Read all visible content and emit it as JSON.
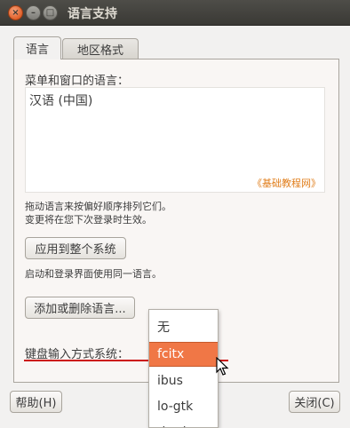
{
  "window": {
    "title": "语言支持"
  },
  "tabs": [
    {
      "label": "语言",
      "active": true
    },
    {
      "label": "地区格式",
      "active": false
    }
  ],
  "language_section": {
    "title": "菜单和窗口的语言：",
    "languages": [
      "汉语 (中国)"
    ],
    "watermark": "《基础教程网》",
    "hint_line1": "拖动语言来按偏好顺序排列它们。",
    "hint_line2": "变更将在您下次登录时生效。"
  },
  "apply_button": "应用到整个系统",
  "login_hint": "启动和登录界面使用同一语言。",
  "add_remove_button": "添加或删除语言...",
  "input_method": {
    "label": "键盘输入方式系统：",
    "options": [
      "无",
      "fcitx",
      "ibus",
      "lo-gtk",
      "th..th"
    ],
    "selected": "fcitx"
  },
  "footer": {
    "help": "帮助(H)",
    "close": "关闭(C)"
  },
  "colors": {
    "accent": "#f07746",
    "titlebar": "#3c3b37",
    "annotation": "#cc1111"
  }
}
